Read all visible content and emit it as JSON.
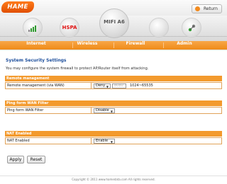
{
  "header": {
    "logo_text": "HAME",
    "return_label": "Return"
  },
  "icons": {
    "hspa_label": "HSPA",
    "center_label": "MIFI A6"
  },
  "nav": {
    "items": [
      {
        "label": "Internet"
      },
      {
        "label": "Wireless"
      },
      {
        "label": "Firewall"
      },
      {
        "label": "Admin"
      }
    ]
  },
  "page": {
    "title": "System Security Settings",
    "description": "You may configure the system firewall to protect AP/Router itself from attacking."
  },
  "sections": {
    "remote": {
      "header": "Remote management",
      "row_label": "Remote management (via WAN)",
      "select_value": "Deny",
      "port_value": "8080",
      "range_text": "1024~65535"
    },
    "ping": {
      "header": "Ping form WAN Filter",
      "row_label": "Ping form WAN Filter",
      "select_value": "Disable"
    },
    "nat": {
      "header": "NAT Enabled",
      "row_label": "NAT Enabled",
      "select_value": "Enable"
    }
  },
  "buttons": {
    "apply": "Apply",
    "reset": "Reset"
  },
  "footer": {
    "text": "Copyright © 2011 www.hamedata.com All rights reserved."
  },
  "colors": {
    "accent": "#ef8a17",
    "title_blue": "#1d4f9c",
    "hspa_red": "#e01010",
    "signal_green": "#2e9a2e"
  }
}
